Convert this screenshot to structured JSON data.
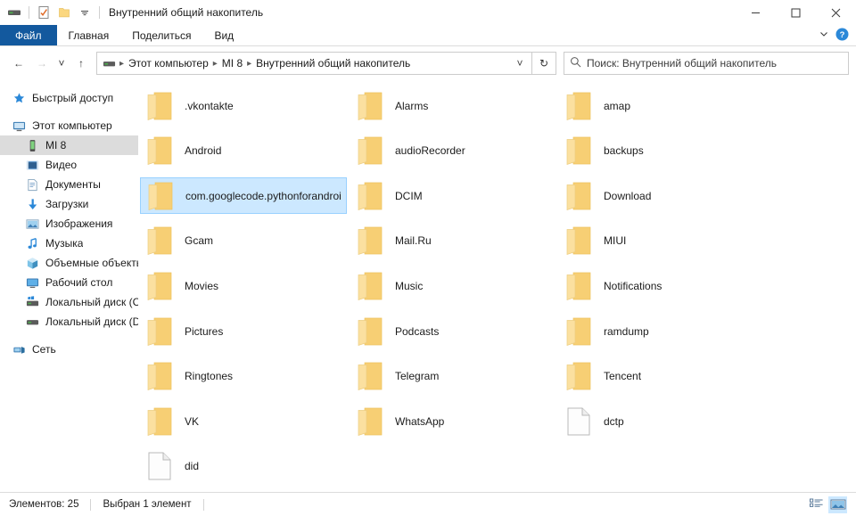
{
  "window": {
    "title": "Внутренний общий накопитель",
    "quick_access": [
      "drive-icon",
      "properties-icon",
      "new-folder-icon",
      "qat-dropdown-icon"
    ],
    "controls": {
      "minimize": "—",
      "maximize": "□",
      "close": "✕"
    }
  },
  "ribbon": {
    "tabs": [
      {
        "label": "Файл",
        "active": true
      },
      {
        "label": "Главная",
        "active": false
      },
      {
        "label": "Поделиться",
        "active": false
      },
      {
        "label": "Вид",
        "active": false
      }
    ],
    "expand_icon": "chevron-down-icon",
    "help_icon": "help-icon"
  },
  "address": {
    "back": "←",
    "forward": "→",
    "recent": "˅",
    "up": "↑",
    "breadcrumbs": [
      "Этот компьютер",
      "MI 8",
      "Внутренний общий накопитель"
    ],
    "dropdown": "˅",
    "refresh": "↻"
  },
  "search": {
    "placeholder": "Поиск: Внутренний общий накопитель",
    "icon": "search-icon"
  },
  "sidebar": {
    "items": [
      {
        "label": "Быстрый доступ",
        "icon": "star-icon",
        "level": "root",
        "selected": false
      },
      {
        "label": "Этот компьютер",
        "icon": "computer-icon",
        "level": "root",
        "selected": false
      },
      {
        "label": "MI 8",
        "icon": "phone-icon",
        "level": "child",
        "selected": true
      },
      {
        "label": "Видео",
        "icon": "video-icon",
        "level": "child",
        "selected": false
      },
      {
        "label": "Документы",
        "icon": "documents-icon",
        "level": "child",
        "selected": false
      },
      {
        "label": "Загрузки",
        "icon": "downloads-icon",
        "level": "child",
        "selected": false
      },
      {
        "label": "Изображения",
        "icon": "pictures-icon",
        "level": "child",
        "selected": false
      },
      {
        "label": "Музыка",
        "icon": "music-icon",
        "level": "child",
        "selected": false
      },
      {
        "label": "Объемные объекты",
        "icon": "3dobjects-icon",
        "level": "child",
        "selected": false
      },
      {
        "label": "Рабочий стол",
        "icon": "desktop-icon",
        "level": "child",
        "selected": false
      },
      {
        "label": "Локальный диск (C",
        "icon": "windows-drive-icon",
        "level": "child",
        "selected": false
      },
      {
        "label": "Локальный диск (D",
        "icon": "drive-icon",
        "level": "child",
        "selected": false
      },
      {
        "label": "Сеть",
        "icon": "network-icon",
        "level": "root",
        "selected": false
      }
    ]
  },
  "files": {
    "items": [
      {
        "name": ".vkontakte",
        "type": "folder",
        "col": 0,
        "row": 0,
        "selected": false
      },
      {
        "name": "Alarms",
        "type": "folder",
        "col": 1,
        "row": 0,
        "selected": false
      },
      {
        "name": "amap",
        "type": "folder",
        "col": 2,
        "row": 0,
        "selected": false
      },
      {
        "name": "Android",
        "type": "folder",
        "col": 0,
        "row": 1,
        "selected": false
      },
      {
        "name": "audioRecorder",
        "type": "folder",
        "col": 1,
        "row": 1,
        "selected": false
      },
      {
        "name": "backups",
        "type": "folder",
        "col": 2,
        "row": 1,
        "selected": false
      },
      {
        "name": "com.googlecode.pythonforandroid",
        "type": "folder",
        "col": 0,
        "row": 2,
        "selected": true
      },
      {
        "name": "DCIM",
        "type": "folder",
        "col": 1,
        "row": 2,
        "selected": false
      },
      {
        "name": "Download",
        "type": "folder",
        "col": 2,
        "row": 2,
        "selected": false
      },
      {
        "name": "Gcam",
        "type": "folder",
        "col": 0,
        "row": 3,
        "selected": false
      },
      {
        "name": "Mail.Ru",
        "type": "folder",
        "col": 1,
        "row": 3,
        "selected": false
      },
      {
        "name": "MIUI",
        "type": "folder",
        "col": 2,
        "row": 3,
        "selected": false
      },
      {
        "name": "Movies",
        "type": "folder",
        "col": 0,
        "row": 4,
        "selected": false
      },
      {
        "name": "Music",
        "type": "folder",
        "col": 1,
        "row": 4,
        "selected": false
      },
      {
        "name": "Notifications",
        "type": "folder",
        "col": 2,
        "row": 4,
        "selected": false
      },
      {
        "name": "Pictures",
        "type": "folder",
        "col": 0,
        "row": 5,
        "selected": false
      },
      {
        "name": "Podcasts",
        "type": "folder",
        "col": 1,
        "row": 5,
        "selected": false
      },
      {
        "name": "ramdump",
        "type": "folder",
        "col": 2,
        "row": 5,
        "selected": false
      },
      {
        "name": "Ringtones",
        "type": "folder",
        "col": 0,
        "row": 6,
        "selected": false
      },
      {
        "name": "Telegram",
        "type": "folder",
        "col": 1,
        "row": 6,
        "selected": false
      },
      {
        "name": "Tencent",
        "type": "folder",
        "col": 2,
        "row": 6,
        "selected": false
      },
      {
        "name": "VK",
        "type": "folder",
        "col": 0,
        "row": 7,
        "selected": false
      },
      {
        "name": "WhatsApp",
        "type": "folder",
        "col": 1,
        "row": 7,
        "selected": false
      },
      {
        "name": "dctp",
        "type": "file",
        "col": 2,
        "row": 7,
        "selected": false
      },
      {
        "name": "did",
        "type": "file",
        "col": 0,
        "row": 8,
        "selected": false
      }
    ]
  },
  "status": {
    "count_label": "Элементов: 25",
    "selection_label": "Выбран 1 элемент",
    "views": [
      {
        "name": "details-view",
        "active": false
      },
      {
        "name": "large-icons-view",
        "active": true
      }
    ]
  },
  "colors": {
    "accent": "#13599e",
    "selection_fill": "#cce8ff",
    "selection_border": "#99d1ff",
    "folder": "#fbd77f",
    "nav_selected": "#dcdcdc"
  }
}
